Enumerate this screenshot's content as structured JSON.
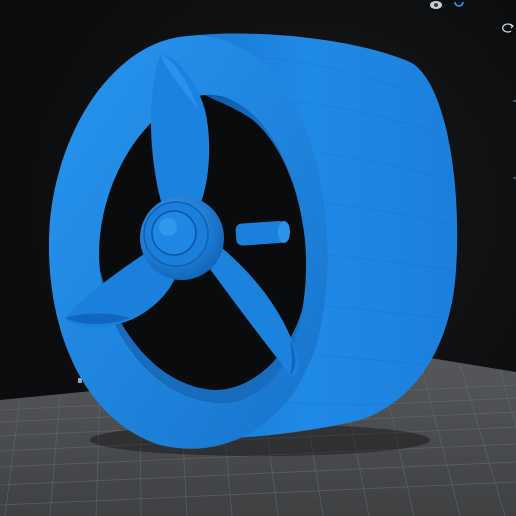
{
  "app": {
    "viewport": "3d-viewport",
    "model": "ducted-fan-propeller"
  },
  "toolbar": {
    "items": [
      {
        "icon": "view-mode-icon",
        "active": false
      },
      {
        "icon": "camera-icon",
        "active": true
      },
      {
        "icon": "rotate-view-icon",
        "active": false
      }
    ]
  },
  "colors": {
    "model": "#1e8be6",
    "model_shadow": "#0d57a8",
    "model_highlight": "#4fb0ff",
    "bed": "#4a4c4e",
    "bed_grid": "#5b5d60",
    "background": "#0b0c0d",
    "accent": "#2d9bff"
  }
}
